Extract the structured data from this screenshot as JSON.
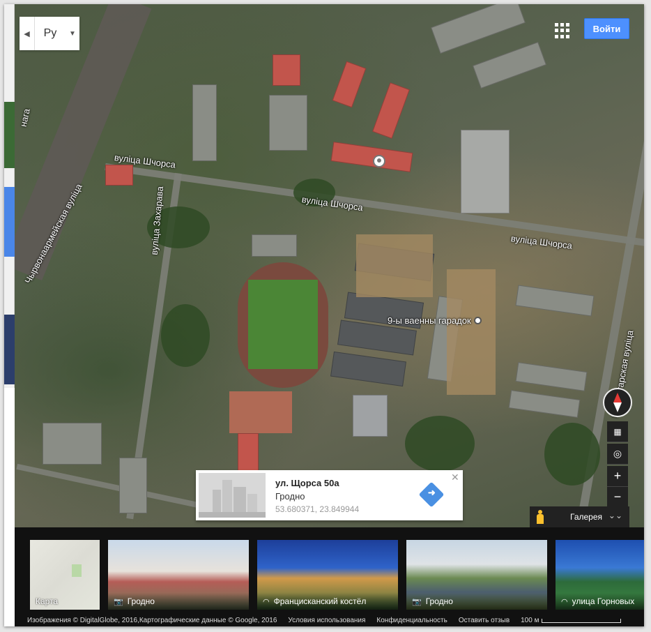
{
  "language_selector": {
    "value": "Ру",
    "back_icon": "chevron-left-icon",
    "dropdown_icon": "caret-down-icon"
  },
  "header": {
    "apps_icon": "apps-grid-icon",
    "login_label": "Войти"
  },
  "map": {
    "streets": {
      "shchorsa_1": "вуліца Шчорса",
      "shchorsa_2": "вуліца Шчорса",
      "shchorsa_3": "вуліца Шчорса",
      "chyrvonaarmeiskaya": "Чырвонаармейская вуліца",
      "zakharava": "вуліца Захарава",
      "proletarskaya": "Пралетарская вуліца",
      "fragment": "нага"
    },
    "poi": {
      "label": "9-ы ваенны гарадок"
    }
  },
  "place_card": {
    "title": "ул. Щорса 50а",
    "city": "Гродно",
    "coordinates": "53.680371, 23.849944",
    "close_icon": "close-icon",
    "directions_icon": "directions-icon"
  },
  "controls": {
    "compass_icon": "compass-icon",
    "layers_icon": "grid-icon",
    "location_icon": "my-location-icon",
    "zoom_in": "+",
    "zoom_out": "−",
    "pegman_icon": "pegman-icon",
    "gallery_label": "Галерея",
    "gallery_icon": "double-chevron-down-icon"
  },
  "gallery": {
    "items": [
      {
        "label": "Карта",
        "icon": ""
      },
      {
        "label": "Гродно",
        "icon": "camera-icon"
      },
      {
        "label": "Францисканский костёл",
        "icon": "panorama-icon"
      },
      {
        "label": "Гродно",
        "icon": "camera-icon"
      },
      {
        "label": "улица Горновых",
        "icon": "panorama-icon"
      }
    ]
  },
  "footer": {
    "imagery": "Изображения © DigitalGlobe, 2016,Картографические данные © Google, 2016",
    "terms": "Условия использования",
    "privacy": "Конфиденциальность",
    "feedback": "Оставить отзыв",
    "scale": "100 м"
  },
  "colors": {
    "accent_blue": "#4d90fe",
    "pin_red": "#e53935",
    "pegman_yellow": "#fbc02d"
  }
}
